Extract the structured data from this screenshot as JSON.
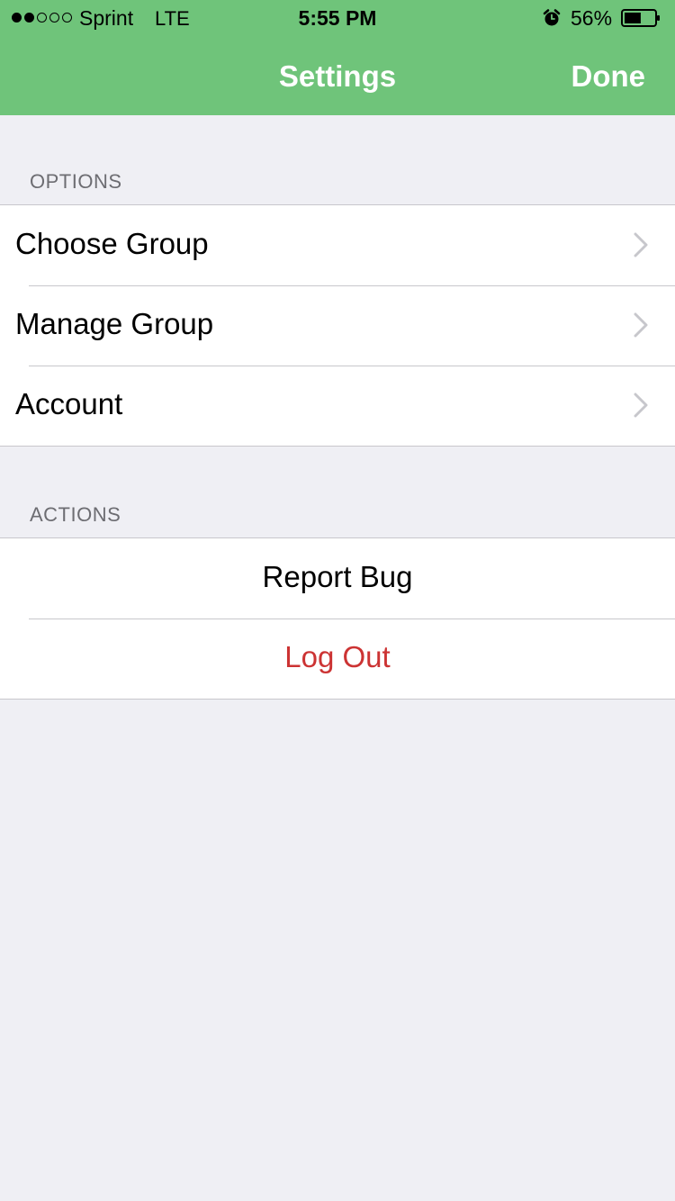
{
  "status_bar": {
    "carrier": "Sprint",
    "network": "LTE",
    "time": "5:55 PM",
    "battery_percent": "56%",
    "battery_level": 0.56,
    "signal_bars_filled": 2,
    "signal_bars_total": 5
  },
  "navbar": {
    "title": "Settings",
    "done_label": "Done",
    "bar_color": "#6fc47a"
  },
  "options": {
    "header": "OPTIONS",
    "items": [
      {
        "label": "Choose Group",
        "icon": "chevron-right-icon"
      },
      {
        "label": "Manage Group",
        "icon": "chevron-right-icon"
      },
      {
        "label": "Account",
        "icon": "chevron-right-icon"
      }
    ]
  },
  "actions": {
    "header": "ACTIONS",
    "report_bug": "Report Bug",
    "log_out": "Log Out",
    "log_out_color": "#cc3333"
  }
}
